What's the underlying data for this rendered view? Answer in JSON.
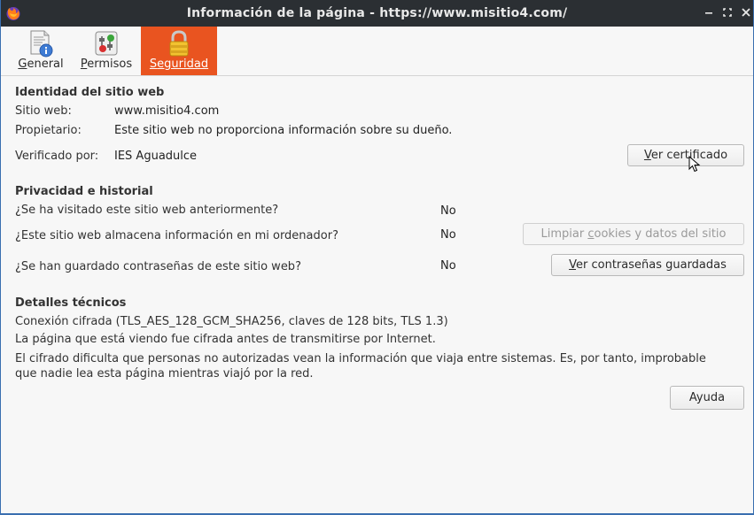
{
  "window": {
    "title": "Información de la página - https://www.misitio4.com/",
    "controls": {
      "minimize_icon": "minimize-icon",
      "maximize_icon": "maximize-icon",
      "close_icon": "close-icon"
    }
  },
  "tabs": [
    {
      "pre": "",
      "accel": "G",
      "post": "eneral",
      "icon": "general-info-icon",
      "active": false
    },
    {
      "pre": "",
      "accel": "P",
      "post": "ermisos",
      "icon": "permissions-icon",
      "active": false
    },
    {
      "pre": "",
      "accel": "S",
      "post": "eguridad",
      "icon": "padlock-icon",
      "active": true
    }
  ],
  "identity": {
    "heading": "Identidad del sitio web",
    "website_label": "Sitio web:",
    "website_value": "www.misitio4.com",
    "owner_label": "Propietario:",
    "owner_value": "Este sitio web no proporciona información sobre su dueño.",
    "verified_label": "Verificado por:",
    "verified_value": "IES Aguadulce",
    "view_cert_button": {
      "pre": "",
      "accel": "V",
      "post": "er certificado"
    }
  },
  "privacy": {
    "heading": "Privacidad e historial",
    "visited_question": "¿Se ha visitado este sitio web anteriormente?",
    "visited_answer": "No",
    "stores_question": "¿Este sitio web almacena información en mi ordenador?",
    "stores_answer": "No",
    "clear_button": {
      "pre": "Limpiar ",
      "accel": "c",
      "post": "ookies y datos del sitio",
      "disabled": true
    },
    "passwords_question": "¿Se han guardado contraseñas de este sitio web?",
    "passwords_answer": "No",
    "passwords_button": {
      "pre": "",
      "accel": "V",
      "post": "er contraseñas guardadas"
    }
  },
  "technical": {
    "heading": "Detalles técnicos",
    "connection": "Conexión cifrada (TLS_AES_128_GCM_SHA256, claves de 128 bits, TLS 1.3)",
    "encrypted_note": "La página que está viendo fue cifrada antes de transmitirse por Internet.",
    "explanation_line1": "El cifrado dificulta que personas no autorizadas vean la información que viaja entre sistemas. Es, por tanto, improbable",
    "explanation_line2": "que nadie lea esta página mientras viajó por la red."
  },
  "help_button": "Ayuda",
  "colors": {
    "titlebar_bg": "#2b2f33",
    "active_tab": "#e95420",
    "window_border": "#3a6fb0"
  }
}
